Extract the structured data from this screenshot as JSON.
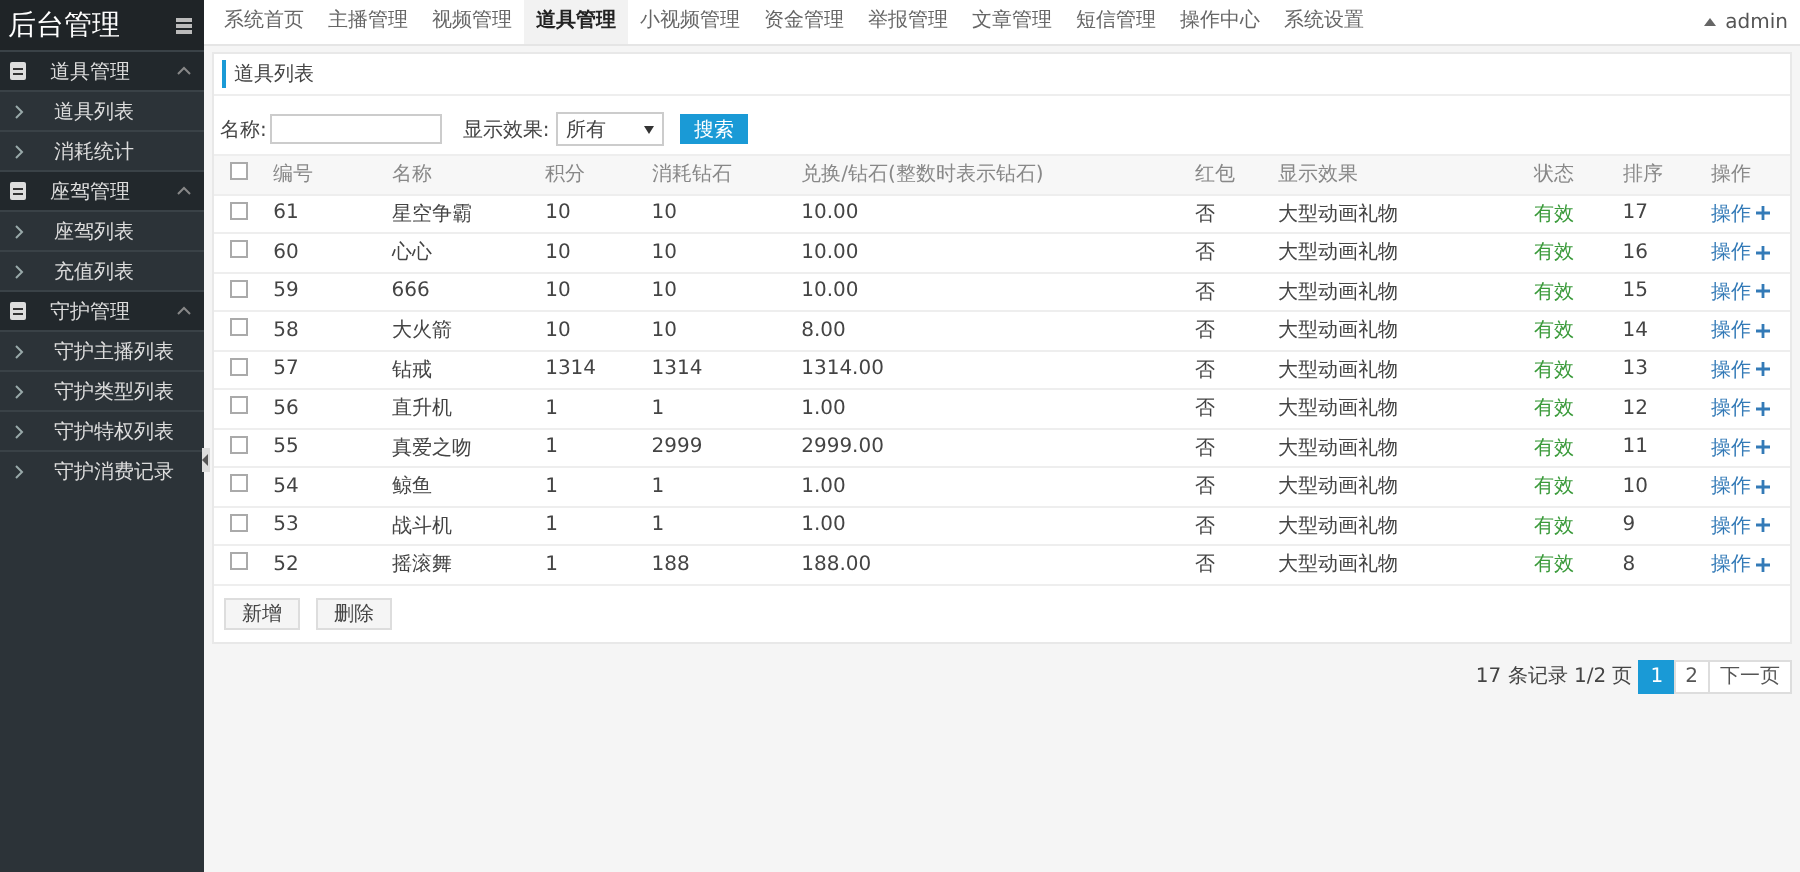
{
  "brand": "后台管理",
  "sidebar": {
    "groups": [
      {
        "label": "道具管理",
        "expanded": true,
        "items": [
          "道具列表",
          "消耗统计"
        ]
      },
      {
        "label": "座驾管理",
        "expanded": true,
        "items": [
          "座驾列表",
          "充值列表"
        ]
      },
      {
        "label": "守护管理",
        "expanded": true,
        "items": [
          "守护主播列表",
          "守护类型列表",
          "守护特权列表",
          "守护消费记录"
        ]
      }
    ]
  },
  "nav": [
    {
      "label": "系统首页",
      "selected": false
    },
    {
      "label": "主播管理",
      "selected": false
    },
    {
      "label": "视频管理",
      "selected": false
    },
    {
      "label": "道具管理",
      "selected": true
    },
    {
      "label": "小视频管理",
      "selected": false
    },
    {
      "label": "资金管理",
      "selected": false
    },
    {
      "label": "举报管理",
      "selected": false
    },
    {
      "label": "文章管理",
      "selected": false
    },
    {
      "label": "短信管理",
      "selected": false
    },
    {
      "label": "操作中心",
      "selected": false
    },
    {
      "label": "系统设置",
      "selected": false
    }
  ],
  "user": "admin",
  "section_title": "道具列表",
  "filter": {
    "name_label": "名称:",
    "effect_label": "显示效果:",
    "effect_value": "所有",
    "search_button": "搜索"
  },
  "table": {
    "header_checked": false,
    "columns": [
      "编号",
      "名称",
      "积分",
      "消耗钻石",
      "兑换/钻石(整数时表示钻石)",
      "红包",
      "显示效果",
      "状态",
      "排序",
      "操作"
    ],
    "rows": [
      {
        "checked": false,
        "cells": [
          "61",
          "星空争霸",
          "10",
          "10",
          "10.00",
          "否",
          "大型动画礼物",
          "有效",
          "17",
          "操作"
        ]
      },
      {
        "checked": false,
        "cells": [
          "60",
          "心心",
          "10",
          "10",
          "10.00",
          "否",
          "大型动画礼物",
          "有效",
          "16",
          "操作"
        ]
      },
      {
        "checked": false,
        "cells": [
          "59",
          "666",
          "10",
          "10",
          "10.00",
          "否",
          "大型动画礼物",
          "有效",
          "15",
          "操作"
        ]
      },
      {
        "checked": false,
        "cells": [
          "58",
          "大火箭",
          "10",
          "10",
          "8.00",
          "否",
          "大型动画礼物",
          "有效",
          "14",
          "操作"
        ]
      },
      {
        "checked": false,
        "cells": [
          "57",
          "钻戒",
          "1314",
          "1314",
          "1314.00",
          "否",
          "大型动画礼物",
          "有效",
          "13",
          "操作"
        ]
      },
      {
        "checked": false,
        "cells": [
          "56",
          "直升机",
          "1",
          "1",
          "1.00",
          "否",
          "大型动画礼物",
          "有效",
          "12",
          "操作"
        ]
      },
      {
        "checked": false,
        "cells": [
          "55",
          "真爱之吻",
          "1",
          "2999",
          "2999.00",
          "否",
          "大型动画礼物",
          "有效",
          "11",
          "操作"
        ]
      },
      {
        "checked": false,
        "cells": [
          "54",
          "鲸鱼",
          "1",
          "1",
          "1.00",
          "否",
          "大型动画礼物",
          "有效",
          "10",
          "操作"
        ]
      },
      {
        "checked": false,
        "cells": [
          "53",
          "战斗机",
          "1",
          "1",
          "1.00",
          "否",
          "大型动画礼物",
          "有效",
          "9",
          "操作"
        ]
      },
      {
        "checked": false,
        "cells": [
          "52",
          "摇滚舞",
          "1",
          "188",
          "188.00",
          "否",
          "大型动画礼物",
          "有效",
          "8",
          "操作"
        ]
      }
    ]
  },
  "actions": [
    "新增",
    "删除"
  ],
  "pagination": {
    "summary": "17 条记录 1/2 页",
    "pages": [
      {
        "label": "1",
        "selected": true
      },
      {
        "label": "2",
        "selected": false
      }
    ],
    "next": "下一页"
  }
}
